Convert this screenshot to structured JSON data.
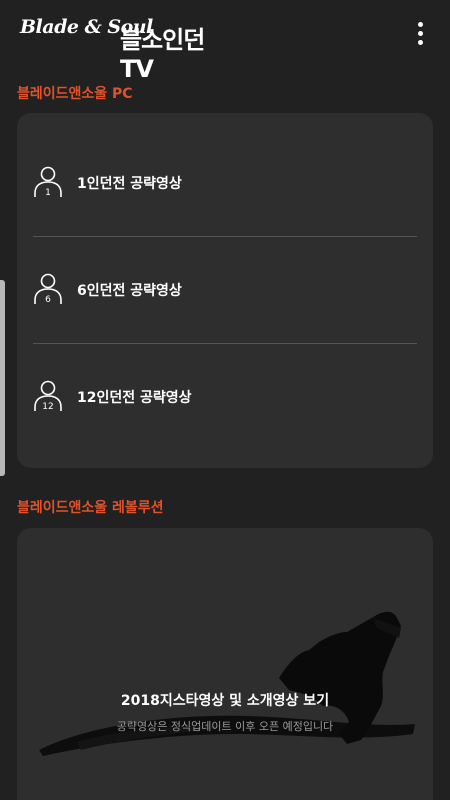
{
  "header": {
    "logo_script": "Blade & Soul",
    "title": "블소인던TV",
    "menu_icon": "more-vertical-icon"
  },
  "sections": [
    {
      "title": "블레이드앤소울 PC",
      "items": [
        {
          "badge": "1",
          "label": "1인던전 공략영상",
          "icon": "person-icon"
        },
        {
          "badge": "6",
          "label": "6인던전 공략영상",
          "icon": "person-icon"
        },
        {
          "badge": "12",
          "label": "12인던전 공략영상",
          "icon": "person-icon"
        }
      ]
    },
    {
      "title": "블레이드앤소울 레볼루션",
      "banner": {
        "title": "2018지스타영상 및 소개영상 보기",
        "subtitle": "공략영상은 정식업데이트 이후 오픈 예정입니다"
      }
    }
  ],
  "colors": {
    "background": "#212121",
    "card": "#2e2e2e",
    "accent": "#e0522a",
    "divider": "#555555",
    "subtext": "#9a9a9a"
  }
}
